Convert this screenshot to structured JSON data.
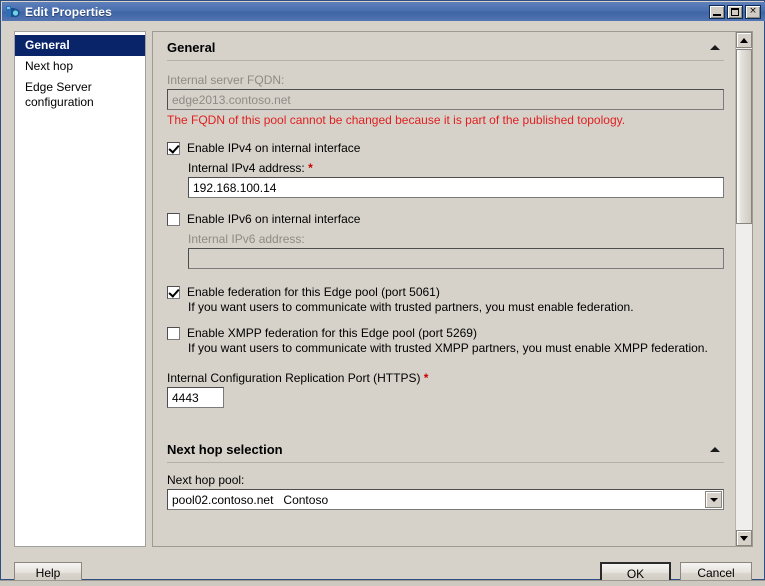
{
  "window": {
    "title": "Edit Properties",
    "icon": "lync-edge-icon",
    "controls": {
      "minimize": "minimize-button",
      "maximize": "maximize-button",
      "close": "×"
    }
  },
  "sidebar": {
    "items": [
      {
        "label": "General",
        "selected": true
      },
      {
        "label": "Next hop",
        "selected": false
      },
      {
        "label": "Edge Server configuration",
        "selected": false
      }
    ]
  },
  "sections": {
    "general": {
      "title": "General",
      "fqdn": {
        "label": "Internal server FQDN:",
        "value": "edge2013.contoso.net",
        "disabled": true
      },
      "fqdn_error": "The FQDN of this pool cannot be changed because it is part of the published topology.",
      "ipv4": {
        "checkbox_label": "Enable IPv4 on internal interface",
        "checked": true,
        "field_label": "Internal IPv4 address:",
        "required": "*",
        "value": "192.168.100.14"
      },
      "ipv6": {
        "checkbox_label": "Enable IPv6 on internal interface",
        "checked": false,
        "field_label": "Internal IPv6 address:",
        "value": ""
      },
      "federation": {
        "checkbox_label": "Enable federation for this Edge pool (port 5061)",
        "checked": true,
        "description": "If you want users to communicate with trusted partners, you must enable federation."
      },
      "xmpp": {
        "checkbox_label": "Enable XMPP federation for this Edge pool (port 5269)",
        "checked": false,
        "description": "If you want users to communicate with trusted XMPP partners, you must enable XMPP federation."
      },
      "replication_port": {
        "label": "Internal Configuration Replication Port (HTTPS)",
        "required": "*",
        "value": "4443"
      }
    },
    "next_hop": {
      "title": "Next hop selection",
      "pool_label": "Next hop pool:",
      "pool_value": "pool02.contoso.net   Contoso"
    }
  },
  "footer": {
    "help": "Help",
    "ok": "OK",
    "cancel": "Cancel"
  },
  "colors": {
    "titlebar": "#4a6fae",
    "selection": "#0a246a",
    "error_text": "#e02020",
    "required_marker": "#cc0000",
    "window_face": "#d6d2ca"
  }
}
